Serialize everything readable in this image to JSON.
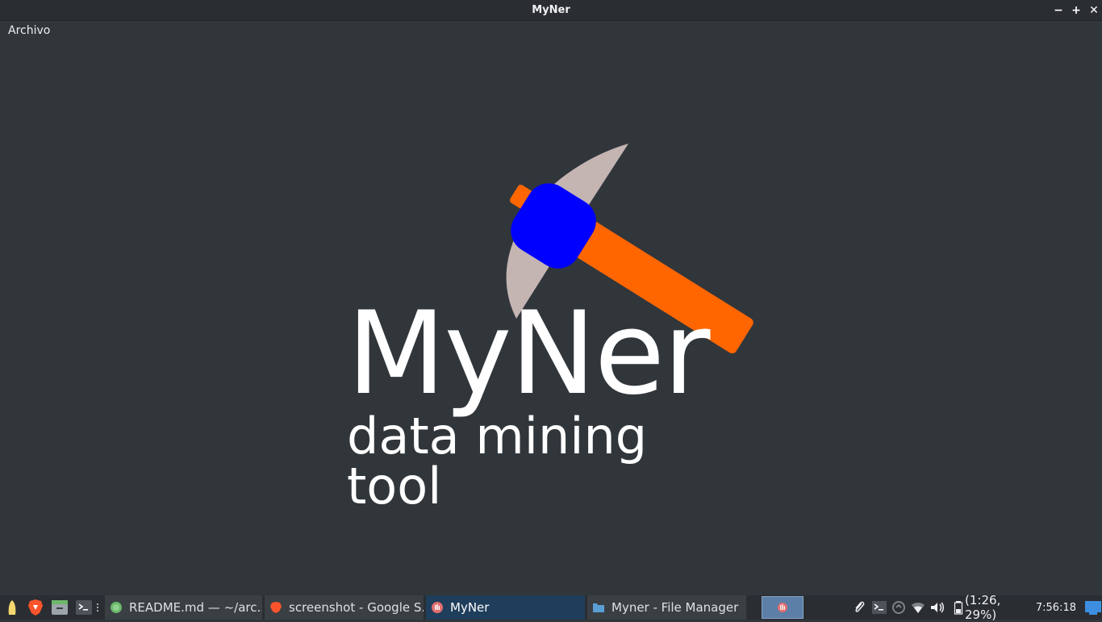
{
  "window": {
    "title": "MyNer"
  },
  "window_buttons": {
    "minimize": "−",
    "maximize": "+",
    "close": "✕"
  },
  "menu": {
    "items": [
      "Archivo"
    ]
  },
  "logo": {
    "title": "MyNer",
    "subtitle": "data mining tool",
    "colors": {
      "blade": "#c4b5b3",
      "head": "#0000ff",
      "handle": "#ff6600"
    }
  },
  "taskbar": {
    "launchers": [
      "app-menu-icon",
      "brave-browser-icon",
      "file-manager-icon",
      "terminal-icon"
    ],
    "tasks": [
      {
        "label": "README.md — ~/arc...",
        "icon": "kate-icon",
        "active": false
      },
      {
        "label": "screenshot - Google S...",
        "icon": "brave-browser-icon",
        "active": false
      },
      {
        "label": "MyNer",
        "icon": "myner-icon",
        "active": true
      },
      {
        "label": "Myner - File Manager",
        "icon": "folder-icon",
        "active": false
      }
    ],
    "tray": {
      "battery": "(1:26, 29%)",
      "clock": "7:56:18"
    }
  }
}
